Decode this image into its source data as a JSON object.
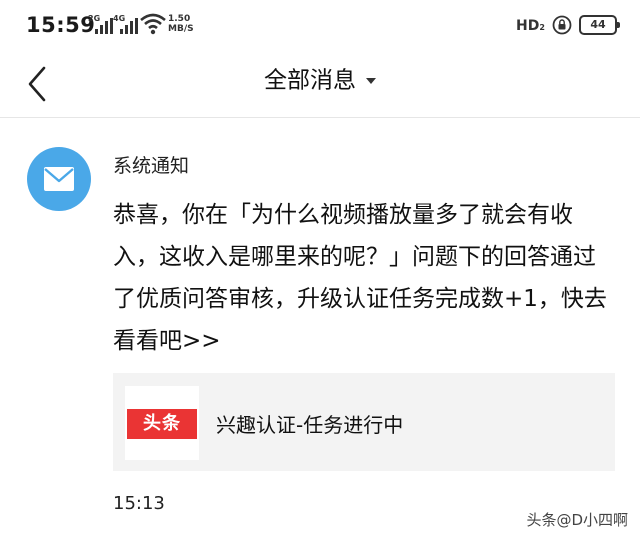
{
  "status_bar": {
    "time": "15:59",
    "signal1_tag": "2G",
    "signal2_tag": "4G",
    "net_speed_value": "1.50",
    "net_speed_unit": "MB/S",
    "hd_label": "HD",
    "hd_sub": "2",
    "battery": "44",
    "icons": [
      "signal-icon",
      "wifi-icon",
      "hd-voice-icon",
      "rotation-lock-icon",
      "battery-icon"
    ]
  },
  "nav": {
    "title": "全部消息",
    "back_icon": "back-chevron-icon",
    "dropdown_icon": "caret-down-icon"
  },
  "message": {
    "sender": "系统通知",
    "avatar_icon": "mail-icon",
    "avatar_color": "#4aa8e8",
    "body": "恭喜，你在「为什么视频播放量多了就会有收入，这收入是哪里来的呢？」问题下的回答通过了优质问答审核，升级认证任务完成数+1，快去看看吧>>",
    "card": {
      "logo_text": "头条",
      "logo_color": "#ea3434",
      "title": "兴趣认证-任务进行中"
    },
    "time": "15:13"
  },
  "watermark": "头条@D小四啊"
}
